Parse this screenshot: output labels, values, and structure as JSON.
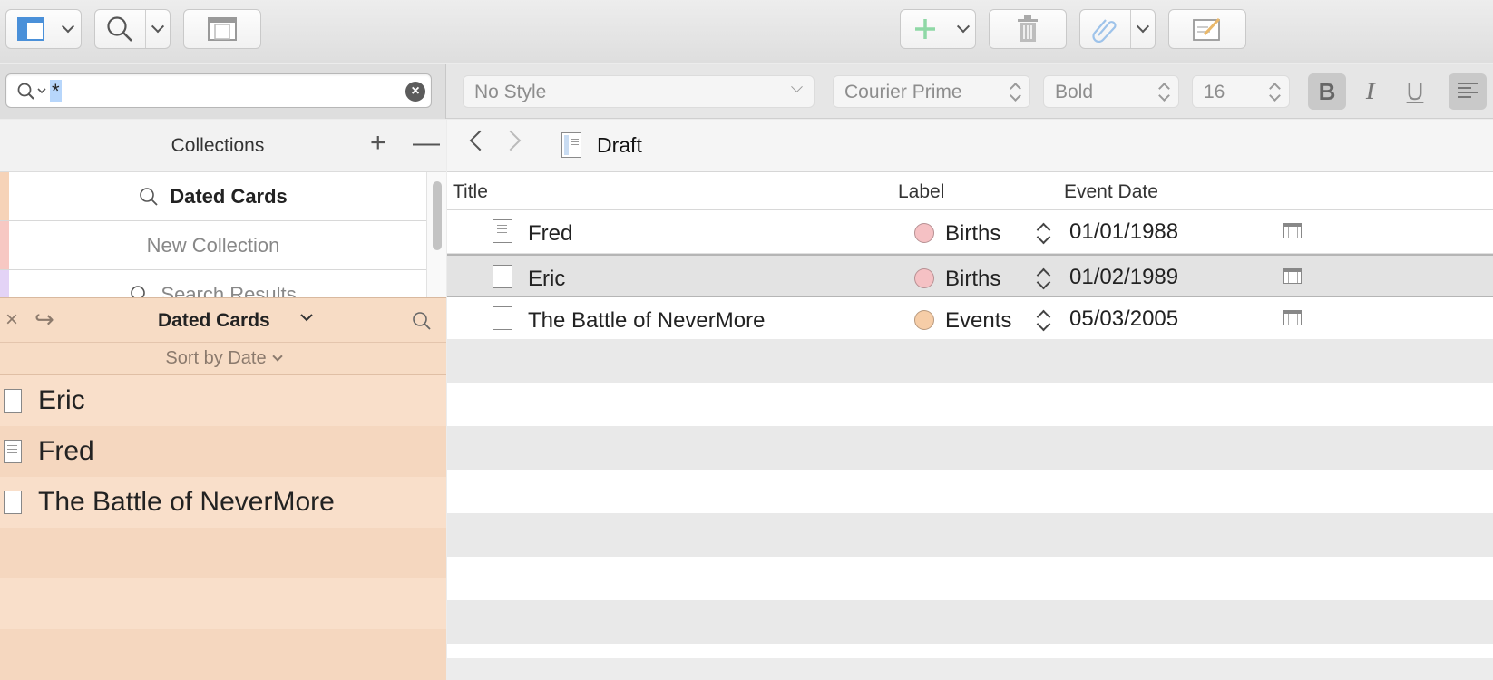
{
  "toolbar": {
    "buttons": [
      {
        "name": "binder-view-icon",
        "has_menu": true
      },
      {
        "name": "search-icon",
        "has_menu": true
      },
      {
        "name": "composition-mode-icon",
        "has_menu": false
      },
      {
        "name": "add-icon",
        "has_menu": true
      },
      {
        "name": "trash-icon",
        "has_menu": false
      },
      {
        "name": "paperclip-icon",
        "has_menu": true
      },
      {
        "name": "compose-icon",
        "has_menu": false
      }
    ]
  },
  "search": {
    "query": "*"
  },
  "format_bar": {
    "style": "No Style",
    "font": "Courier Prime",
    "weight": "Bold",
    "size": "16",
    "bold": "B",
    "italic": "I",
    "underline": "U"
  },
  "collections": {
    "header": "Collections",
    "add": "+",
    "remove": "—",
    "items": [
      {
        "label": "Dated Cards",
        "icon": "search-icon",
        "bold": true,
        "color": "#f6d3b8"
      },
      {
        "label": "New Collection",
        "icon": "",
        "bold": false,
        "color": "#f7c8c3"
      },
      {
        "label": "Search Results",
        "icon": "search-icon",
        "bold": false,
        "color": "#e3d3f6"
      }
    ]
  },
  "collection_tab": {
    "name": "Dated Cards",
    "sort_label": "Sort by Date",
    "color": "#f7dcc5"
  },
  "cards": [
    {
      "title": "Eric",
      "type": "blank"
    },
    {
      "title": "Fred",
      "type": "text"
    },
    {
      "title": "The Battle of NeverMore",
      "type": "blank"
    }
  ],
  "editor": {
    "breadcrumb": "Draft",
    "columns": {
      "title": "Title",
      "label": "Label",
      "event_date": "Event Date"
    },
    "rows": [
      {
        "title": "Fred",
        "type": "text",
        "label": "Births",
        "label_color": "#f5c1c4",
        "date": "01/01/1988",
        "selected": false
      },
      {
        "title": "Eric",
        "type": "blank",
        "label": "Births",
        "label_color": "#f5c1c4",
        "date": "01/02/1989",
        "selected": true
      },
      {
        "title": "The Battle of NeverMore",
        "type": "blank",
        "label": "Events",
        "label_color": "#f6cda7",
        "date": "05/03/2005",
        "selected": false
      }
    ]
  }
}
